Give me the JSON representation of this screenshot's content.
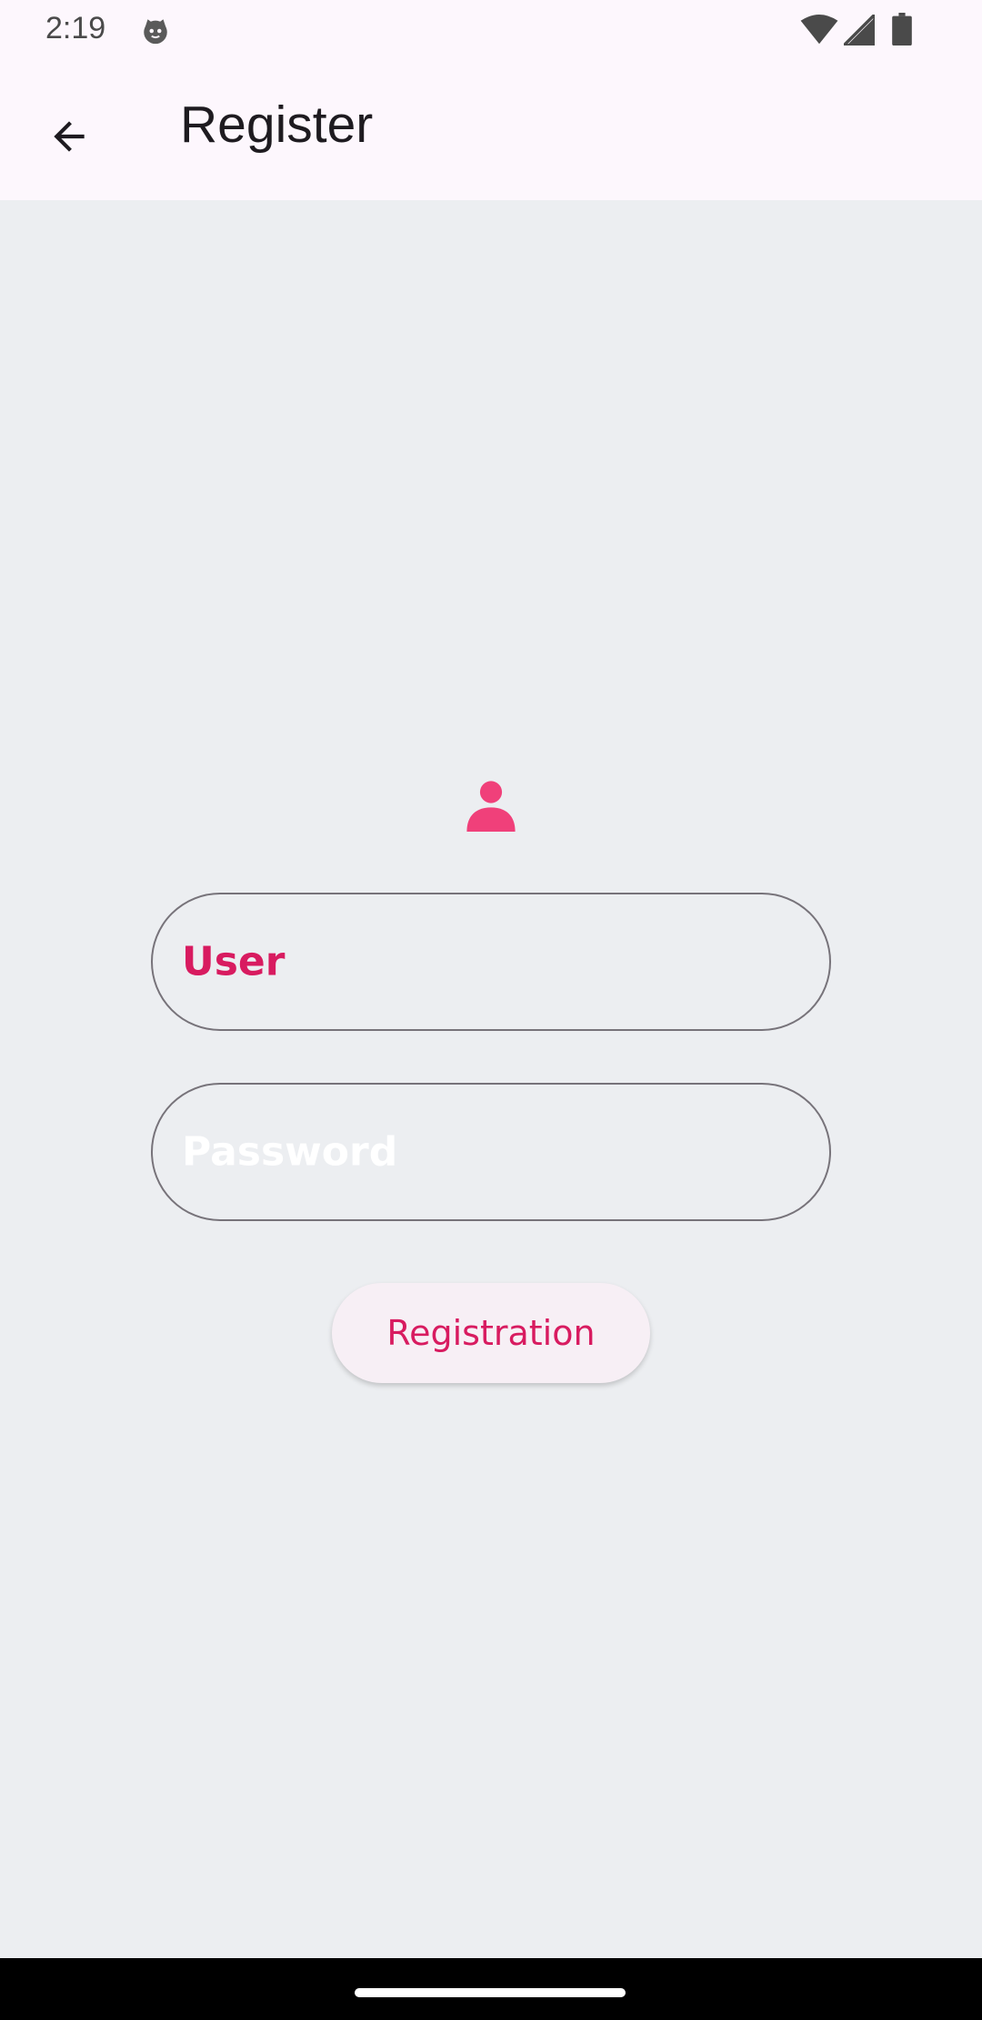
{
  "status_bar": {
    "time": "2:19",
    "icons": [
      "cat-icon",
      "wifi-icon",
      "signal-icon",
      "battery-icon"
    ]
  },
  "app_bar": {
    "title": "Register",
    "back_icon": "arrow-back-icon"
  },
  "form": {
    "avatar_icon": "person-icon",
    "user_field": {
      "value": "User"
    },
    "password_field": {
      "placeholder": "Password"
    },
    "submit_label": "Registration"
  },
  "colors": {
    "accent": "#d81b60",
    "icon_pink": "#f0407a",
    "background": "#eceef1",
    "app_bar": "#fdf7fd",
    "outline": "#77737a"
  }
}
